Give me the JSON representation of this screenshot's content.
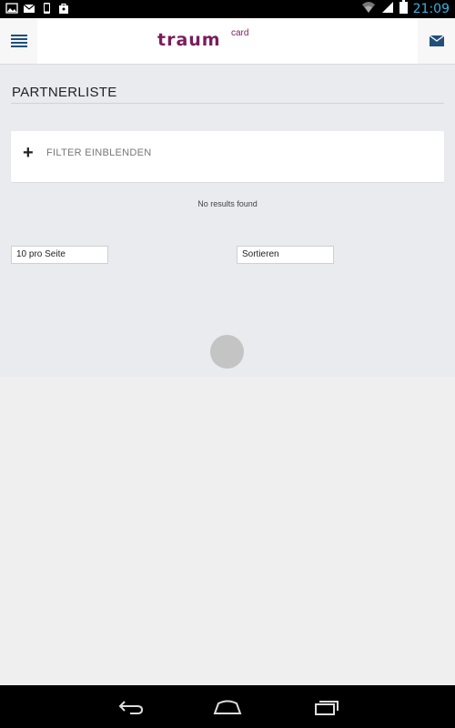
{
  "status_bar": {
    "time": "21:09",
    "icons": [
      "image-icon",
      "mail-icon",
      "phone-icon",
      "shop-bag-icon",
      "wifi-icon",
      "signal-icon",
      "battery-icon"
    ]
  },
  "header": {
    "logo_text": "traum",
    "logo_sub": "card",
    "brand_color": "#7b1c5e"
  },
  "page": {
    "title": "PARTNERLISTE",
    "filter_label": "FILTER EINBLENDEN",
    "filter_icon": "+",
    "no_results": "No results found"
  },
  "controls": {
    "per_page_value": "10 pro Seite",
    "sort_value": "Sortieren"
  }
}
